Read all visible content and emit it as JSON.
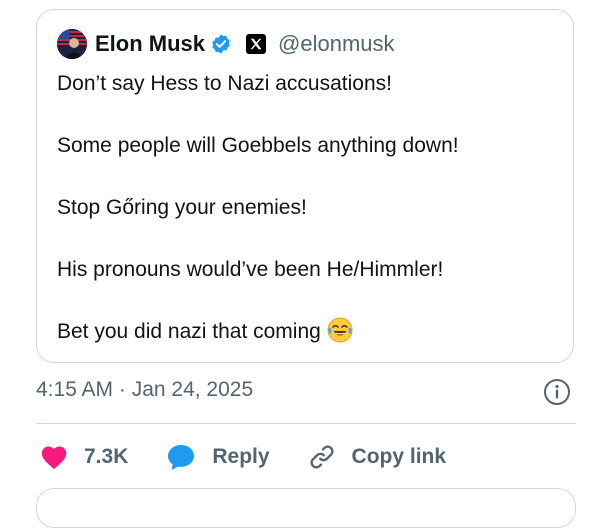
{
  "author": {
    "display_name": "Elon Musk",
    "handle": "@elonmusk",
    "verified": true,
    "avatar_icon": "avatar-photo"
  },
  "tweet": {
    "lines": [
      "Don’t say Hess to Nazi accusations!",
      "Some people will Goebbels anything down!",
      "Stop Gőring your enemies!",
      "His pronouns would’ve been He/Himmler!",
      "Bet you did nazi that coming"
    ],
    "trailing_emoji": "face-with-tears-of-joy"
  },
  "meta": {
    "timestamp": "4:15 AM · Jan 24, 2025"
  },
  "actions": {
    "like_count": "7.3K",
    "reply_label": "Reply",
    "copy_link_label": "Copy link"
  },
  "colors": {
    "like": "#f91880",
    "reply": "#1d9bf0",
    "verified": "#1d9bf0",
    "secondary_text": "#536471",
    "border": "#cfd9de"
  }
}
